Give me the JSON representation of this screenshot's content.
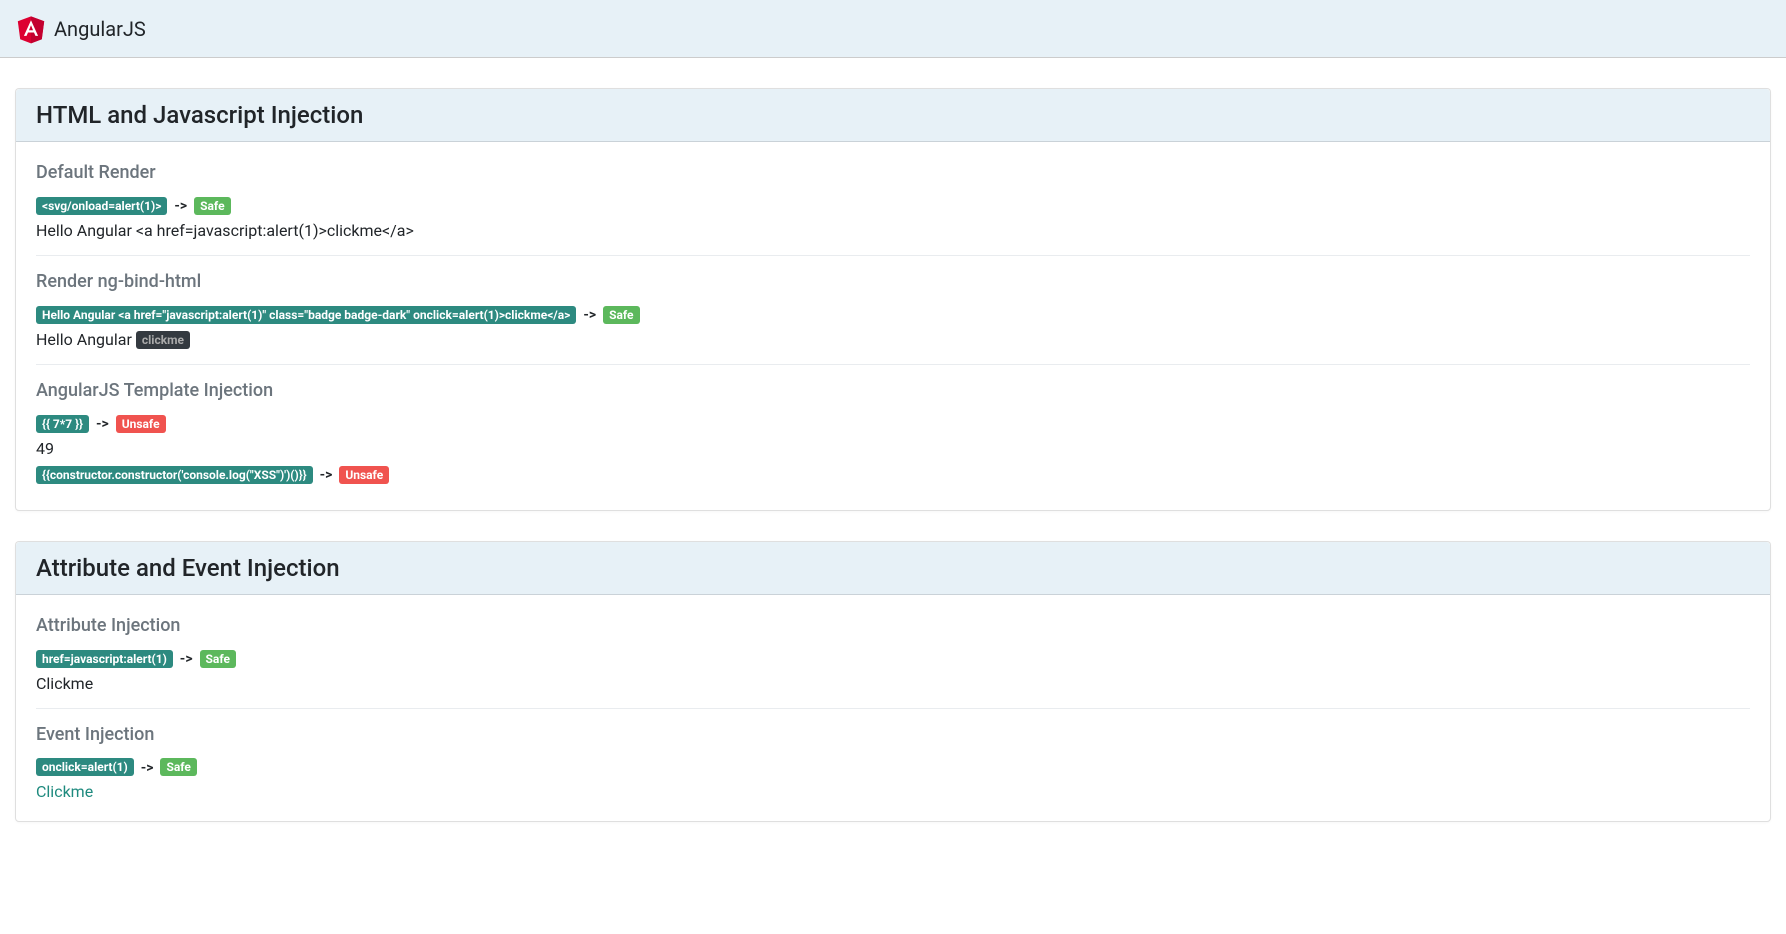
{
  "navbar": {
    "title": "AngularJS"
  },
  "arrow": "->",
  "labels": {
    "safe": "Safe",
    "unsafe": "Unsafe"
  },
  "panel1": {
    "title": "HTML and Javascript Injection",
    "default_render": {
      "heading": "Default Render",
      "payload": "<svg/onload=alert(1)>",
      "status": "safe",
      "output": "Hello Angular <a href=javascript:alert(1)>clickme</a>"
    },
    "ng_bind_html": {
      "heading": "Render ng-bind-html",
      "payload": "Hello Angular <a href=\"javascript:alert(1)\" class=\"badge badge-dark\" onclick=alert(1)>clickme</a>",
      "status": "safe",
      "output_prefix": "Hello Angular ",
      "output_badge": "clickme"
    },
    "template_injection": {
      "heading": "AngularJS Template Injection",
      "item1": {
        "payload": "{{ 7*7 }}",
        "status": "unsafe",
        "output": "49"
      },
      "item2": {
        "payload": "{{constructor.constructor('console.log(\"XSS\")')()}}",
        "status": "unsafe"
      }
    }
  },
  "panel2": {
    "title": "Attribute and Event Injection",
    "attribute_injection": {
      "heading": "Attribute Injection",
      "payload": "href=javascript:alert(1)",
      "status": "safe",
      "output": "Clickme"
    },
    "event_injection": {
      "heading": "Event Injection",
      "payload": "onclick=alert(1)",
      "status": "safe",
      "output": "Clickme"
    }
  }
}
